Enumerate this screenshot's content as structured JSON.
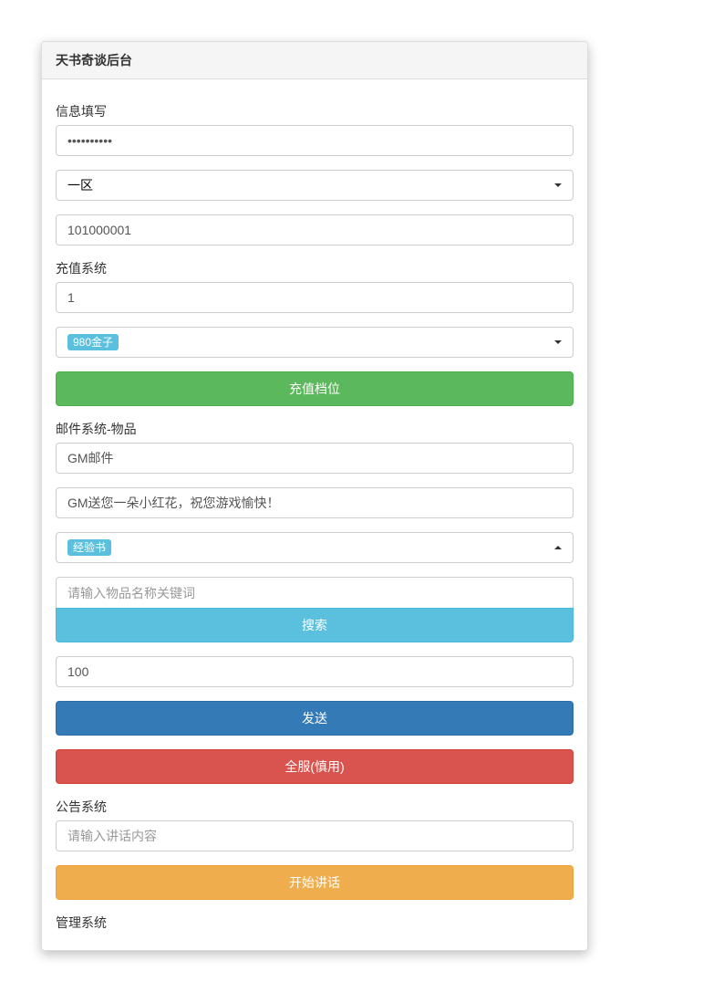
{
  "panel": {
    "title": "天书奇谈后台"
  },
  "info_section": {
    "label": "信息填写",
    "password_value": "••••••••••",
    "region_selected": "一区",
    "account_value": "101000001"
  },
  "recharge_section": {
    "label": "充值系统",
    "amount_value": "1",
    "tier_selected": "980金子",
    "submit_label": "充值档位"
  },
  "mail_section": {
    "label": "邮件系统-物品",
    "title_value": "GM邮件",
    "content_value": "GM送您一朵小红花，祝您游戏愉快！",
    "item_selected": "经验书",
    "search_placeholder": "请输入物品名称关键词",
    "search_label": "搜索",
    "quantity_value": "100",
    "send_label": "发送",
    "broadcast_label": "全服(慎用)"
  },
  "notice_section": {
    "label": "公告系统",
    "content_placeholder": "请输入讲话内容",
    "start_label": "开始讲话"
  },
  "manage_section": {
    "label": "管理系统"
  }
}
